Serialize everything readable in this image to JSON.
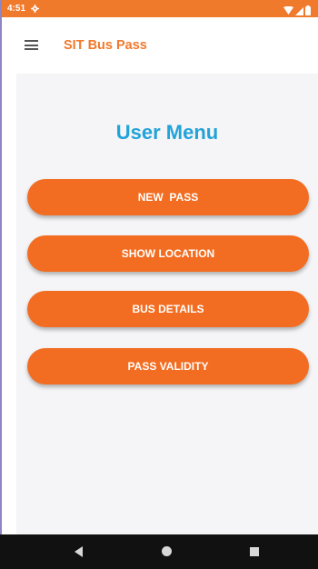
{
  "status_bar": {
    "time": "4:51",
    "background": "#f07a2c",
    "icons": [
      "settings-icon",
      "wifi-icon",
      "signal-icon",
      "battery-icon"
    ]
  },
  "app_bar": {
    "title": "SIT Bus Pass",
    "menu_icon": "hamburger-menu-icon",
    "title_color": "#f07a2c"
  },
  "main": {
    "heading": "User Menu",
    "heading_color": "#21a3d8",
    "button_color": "#f26d21",
    "buttons": [
      {
        "label": "NEW  PASS"
      },
      {
        "label": "SHOW LOCATION"
      },
      {
        "label": "BUS DETAILS"
      },
      {
        "label": "PASS VALIDITY"
      }
    ]
  },
  "nav_bar": {
    "icons": [
      "back-icon",
      "home-icon",
      "recents-icon"
    ]
  }
}
